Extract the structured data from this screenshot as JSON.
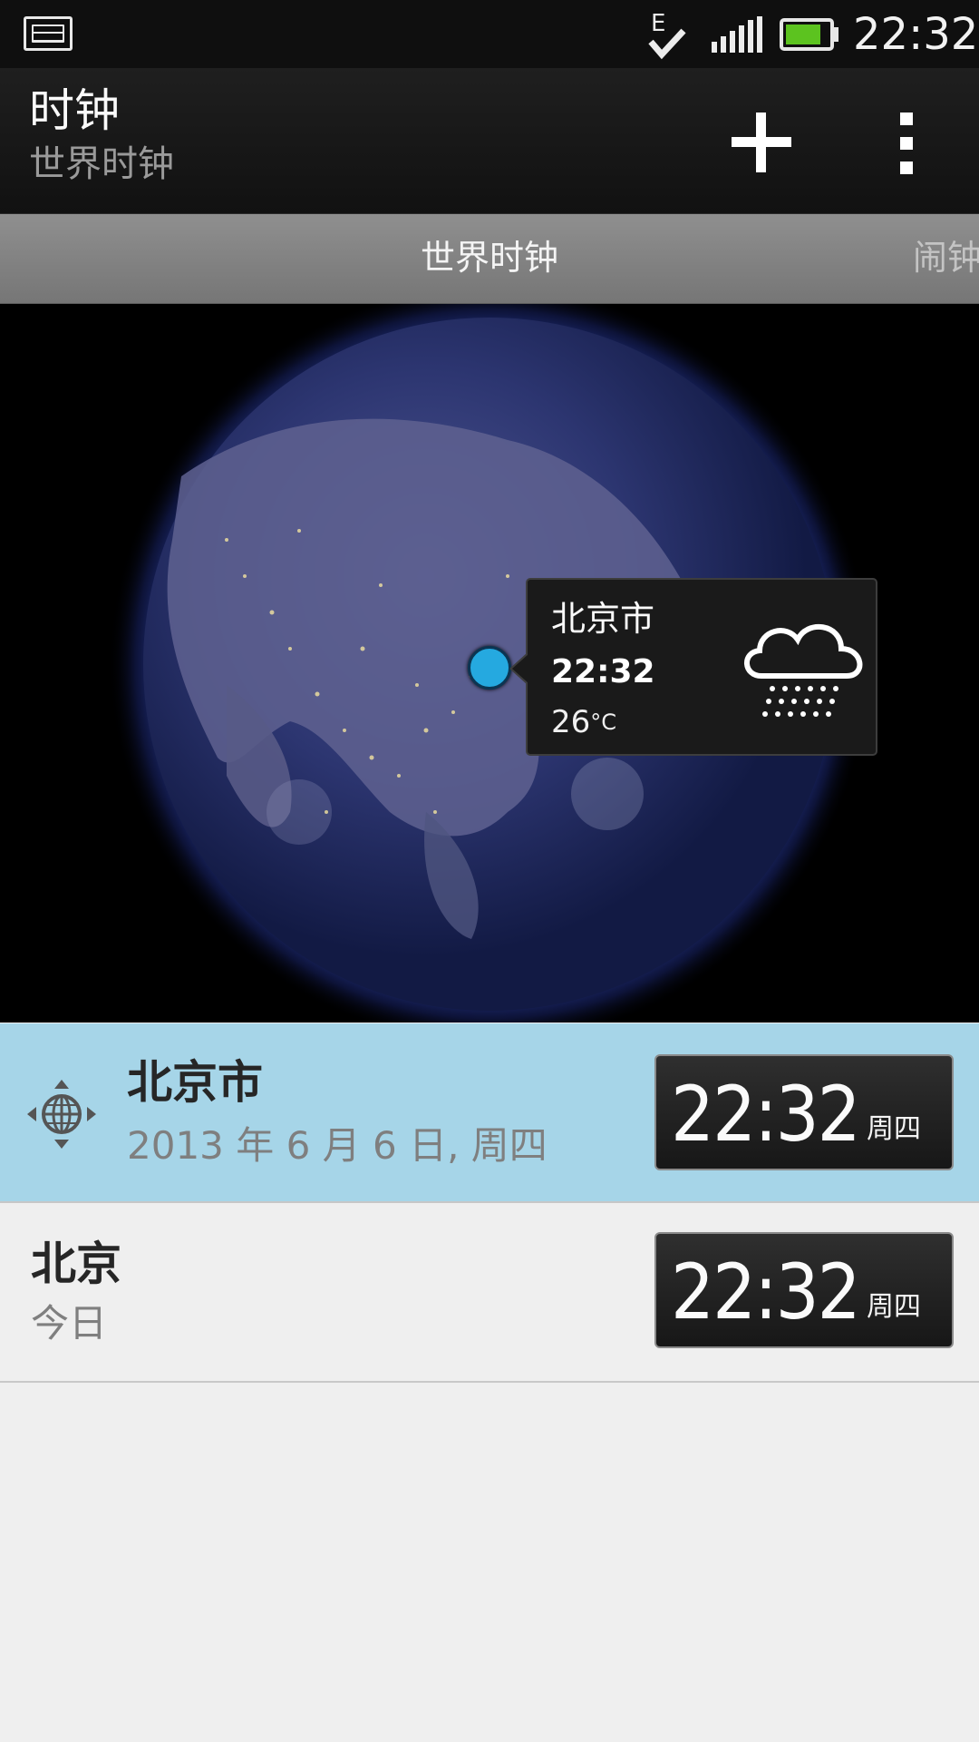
{
  "status_bar": {
    "time": "22:32",
    "network_letter": "E",
    "icons": [
      "gallery-icon",
      "data-sync-icon",
      "signal-icon",
      "battery-icon"
    ],
    "battery_color": "#5cc31f"
  },
  "header": {
    "title": "时钟",
    "subtitle": "世界时钟",
    "add_icon": "plus-icon",
    "menu_icon": "overflow-menu-icon"
  },
  "tabs": [
    {
      "label": "世界时钟",
      "active": true
    },
    {
      "label": "闹钟",
      "active": false
    }
  ],
  "map_popup": {
    "city": "北京市",
    "time": "22:32",
    "temperature": "26",
    "unit": "°C",
    "weather_icon": "rain-cloud-icon",
    "pin_color": "#25a9e0"
  },
  "clock_list": [
    {
      "city": "北京市",
      "date": "2013 年 6 月 6 日, 周四",
      "time": "22:32",
      "weekday": "周四",
      "icon": "location-globe-icon",
      "highlight_color": "#a6d5e8"
    },
    {
      "city": "北京",
      "date": "今日",
      "time": "22:32",
      "weekday": "周四"
    }
  ]
}
